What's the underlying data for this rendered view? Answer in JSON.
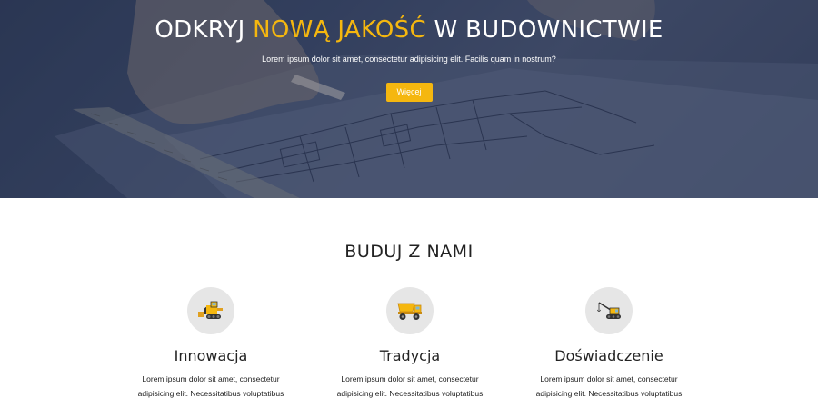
{
  "hero": {
    "title_part1": "ODKRYJ ",
    "title_accent": "NOWĄ JAKOŚĆ",
    "title_part2": " W BUDOWNICTWIE",
    "subtitle": "Lorem ipsum dolor sit amet, consectetur adipisicing elit. Facilis quam in nostrum?",
    "button_label": "Więcej",
    "accent_color": "#f5b70f"
  },
  "section": {
    "title": "BUDUJ Z NAMI"
  },
  "features": [
    {
      "icon": "bulldozer-icon",
      "title": "Innowacja",
      "text_line1": "Lorem ipsum dolor sit amet, consectetur",
      "text_line2": "adipisicing elit. Necessitatibus voluptatibus"
    },
    {
      "icon": "dump-truck-icon",
      "title": "Tradycja",
      "text_line1": "Lorem ipsum dolor sit amet, consectetur",
      "text_line2": "adipisicing elit. Necessitatibus voluptatibus"
    },
    {
      "icon": "crane-icon",
      "title": "Doświadczenie",
      "text_line1": "Lorem ipsum dolor sit amet, consectetur",
      "text_line2": "adipisicing elit. Necessitatibus voluptatibus"
    }
  ]
}
